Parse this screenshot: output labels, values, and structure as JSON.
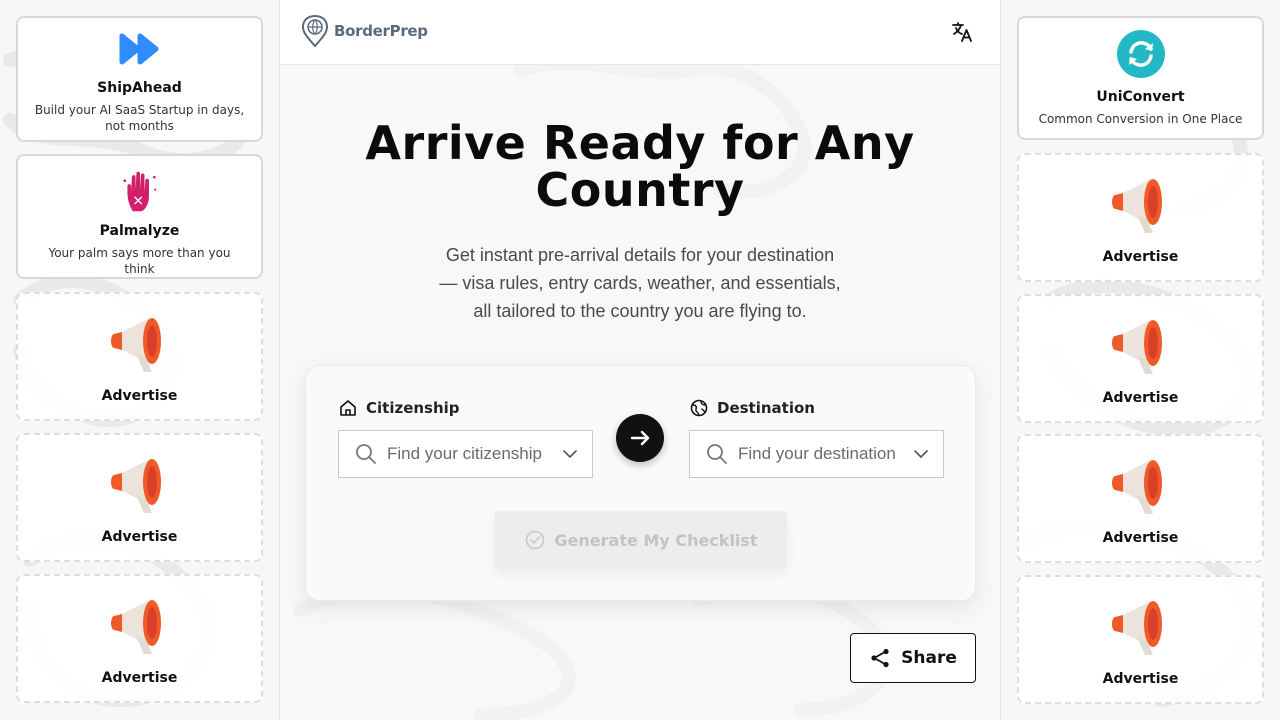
{
  "app": {
    "name": "BorderPrep"
  },
  "left_ads": [
    {
      "type": "product",
      "title": "ShipAhead",
      "subtitle": "Build your AI SaaS Startup in days, not months",
      "icon": "fast-forward-icon"
    },
    {
      "type": "product",
      "title": "Palmalyze",
      "subtitle": "Your palm says more than you think",
      "icon": "palm-hand-icon"
    },
    {
      "type": "slot",
      "title": "Advertise",
      "icon": "megaphone-icon"
    },
    {
      "type": "slot",
      "title": "Advertise",
      "icon": "megaphone-icon"
    },
    {
      "type": "slot",
      "title": "Advertise",
      "icon": "megaphone-icon"
    }
  ],
  "right_ads": [
    {
      "type": "product",
      "title": "UniConvert",
      "subtitle": "Common Conversion in One Place",
      "icon": "refresh-icon"
    },
    {
      "type": "slot",
      "title": "Advertise",
      "icon": "megaphone-icon"
    },
    {
      "type": "slot",
      "title": "Advertise",
      "icon": "megaphone-icon"
    },
    {
      "type": "slot",
      "title": "Advertise",
      "icon": "megaphone-icon"
    },
    {
      "type": "slot",
      "title": "Advertise",
      "icon": "megaphone-icon"
    }
  ],
  "hero": {
    "title_line1": "Arrive Ready for Any",
    "title_line2": "Country",
    "sub_line1": "Get instant pre-arrival details for your destination",
    "sub_line2": "— visa rules, entry cards, weather, and essentials,",
    "sub_line3": "all tailored to the country you are flying to."
  },
  "form": {
    "citizenship_label": "Citizenship",
    "citizenship_placeholder": "Find your citizenship",
    "destination_label": "Destination",
    "destination_placeholder": "Find your destination",
    "generate_label": "Generate My Checklist"
  },
  "share": {
    "label": "Share"
  },
  "colors": {
    "accent_blue": "#2f8cff",
    "teal": "#22b8c6",
    "magenta": "#d21f6b",
    "megaphone_orange": "#f05a28"
  }
}
